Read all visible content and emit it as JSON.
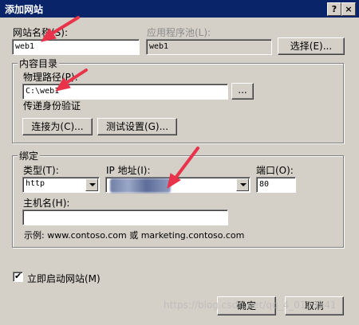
{
  "window": {
    "title": "添加网站",
    "help_button": "?",
    "close_button": "×"
  },
  "site": {
    "name_label": "网站名称(S):",
    "name_value": "web1",
    "app_pool_label": "应用程序池(L):",
    "app_pool_value": "web1",
    "select_button": "选择(E)..."
  },
  "content": {
    "group_title": "内容目录",
    "physical_path_label": "物理路径(P):",
    "physical_path_value": "C:\\web1",
    "browse_button": "...",
    "pass_through_label": "传递身份验证",
    "connect_as_button": "连接为(C)...",
    "test_settings_button": "测试设置(G)..."
  },
  "binding": {
    "group_title": "绑定",
    "type_label": "类型(T):",
    "type_value": "http",
    "ip_label": "IP 地址(I):",
    "ip_value": "",
    "port_label": "端口(O):",
    "port_value": "80",
    "hostname_label": "主机名(H):",
    "hostname_value": "",
    "example_text": "示例: www.contoso.com 或 marketing.contoso.com"
  },
  "start_site": {
    "label": "立即启动网站(M)",
    "checked": true
  },
  "footer": {
    "ok_button": "确定",
    "cancel_button": "取消"
  },
  "watermark": "https://blog.csdn.net/qq_4_0123541",
  "colors": {
    "titlebar": "#0a246a",
    "dialog": "#d4d0c8",
    "arrow": "#e8334a"
  }
}
